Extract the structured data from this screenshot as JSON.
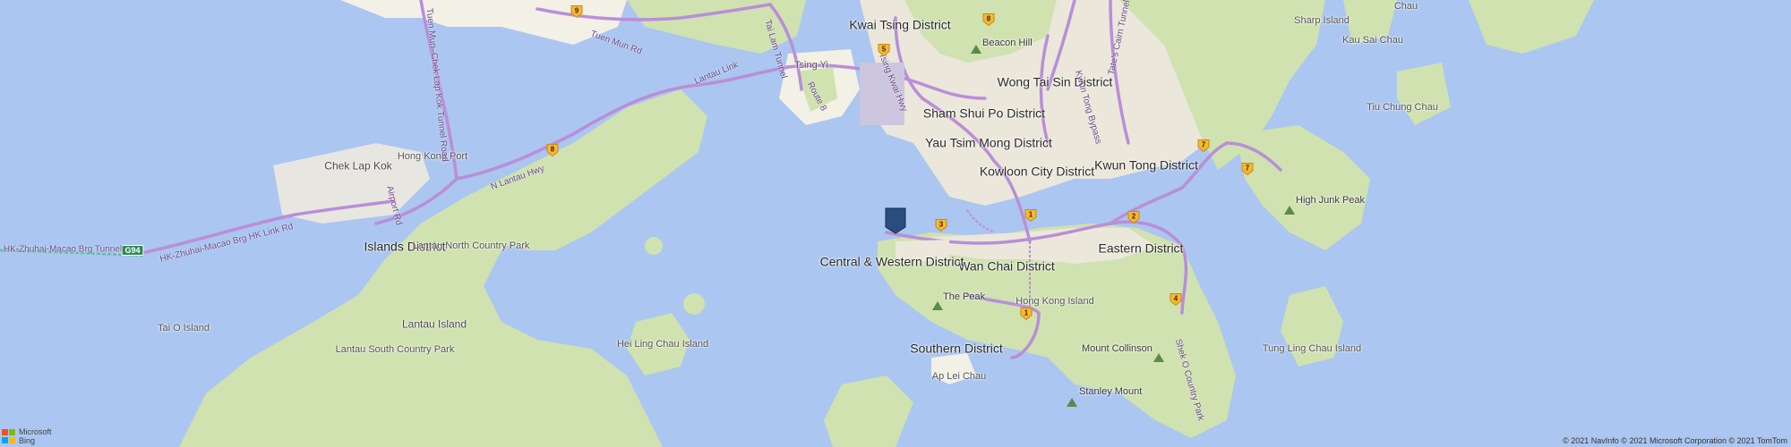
{
  "map": {
    "districts": [
      {
        "id": "kwai-tsing",
        "name": "Kwai Tsing District"
      },
      {
        "id": "wong-tai-sin",
        "name": "Wong Tai Sin District"
      },
      {
        "id": "sham-shui-po",
        "name": "Sham Shui Po District"
      },
      {
        "id": "yau-tsim-mong",
        "name": "Yau Tsim Mong District"
      },
      {
        "id": "kowloon-city",
        "name": "Kowloon City District"
      },
      {
        "id": "kwun-tong",
        "name": "Kwun Tong District"
      },
      {
        "id": "eastern",
        "name": "Eastern District"
      },
      {
        "id": "wan-chai",
        "name": "Wan Chai District"
      },
      {
        "id": "central-western",
        "name": "Central & Western District"
      },
      {
        "id": "southern",
        "name": "Southern District"
      },
      {
        "id": "islands",
        "name": "Islands District"
      }
    ],
    "places": [
      {
        "id": "chek-lap-kok",
        "name": "Chek Lap Kok"
      },
      {
        "id": "hong-kong-port",
        "name": "Hong Kong Port"
      },
      {
        "id": "lantau-north",
        "name": "Lantau North Country Park"
      },
      {
        "id": "lantau-island",
        "name": "Lantau Island"
      },
      {
        "id": "lantau-south",
        "name": "Lantau South Country Park"
      },
      {
        "id": "tai-o",
        "name": "Tai O Island"
      },
      {
        "id": "hei-ling-chau",
        "name": "Hei Ling Chau Island"
      },
      {
        "id": "ap-lei-chau",
        "name": "Ap Lei Chau"
      },
      {
        "id": "tsing-yi",
        "name": "Tsing Yi"
      },
      {
        "id": "hong-kong-island",
        "name": "Hong Kong Island"
      },
      {
        "id": "tung-ling-chau",
        "name": "Tung Ling Chau Island"
      },
      {
        "id": "tiu-chung-chau",
        "name": "Tiu Chung Chau"
      },
      {
        "id": "kau-sai-chau",
        "name": "Kau Sai Chau"
      },
      {
        "id": "sharp-island",
        "name": "Sharp Island"
      },
      {
        "id": "chau",
        "name": "Chau"
      }
    ],
    "pois": [
      {
        "id": "beacon-hill",
        "name": "Beacon Hill"
      },
      {
        "id": "the-peak",
        "name": "The Peak"
      },
      {
        "id": "high-junk-peak",
        "name": "High Junk Peak"
      },
      {
        "id": "mount-collinson",
        "name": "Mount Collinson"
      },
      {
        "id": "stanley-mount",
        "name": "Stanley Mount"
      }
    ],
    "roads": [
      {
        "id": "tuen-mun-chek-lap-kok",
        "name": "Tuen Mun–Chek Lap Kok Tunnel Road"
      },
      {
        "id": "tuen-mun-rd",
        "name": "Tuen Mun Rd"
      },
      {
        "id": "lantau-link",
        "name": "Lantau Link"
      },
      {
        "id": "n-lantau-hwy",
        "name": "N Lantau Hwy"
      },
      {
        "id": "airport-rd",
        "name": "Airport Rd"
      },
      {
        "id": "hzmb-tunnel",
        "name": "HK-Zhuhai-Macao Brg Tunnel"
      },
      {
        "id": "hzmb-link",
        "name": "HK-Zhuhai-Macao Brg HK Link Rd"
      },
      {
        "id": "route-8",
        "name": "Route 8"
      },
      {
        "id": "tai-lam-tunnel",
        "name": "Tai Lam Tunnel"
      },
      {
        "id": "tsing-kwai-hwy",
        "name": "Tsing Kwai Hwy"
      },
      {
        "id": "tate-cairn",
        "name": "Tate's Cairn Tunnel"
      },
      {
        "id": "kwun-tong-bp",
        "name": "Kwun Tong Bypass"
      },
      {
        "id": "shek-o-country-park",
        "name": "Shek O Country Park"
      }
    ],
    "route_shields": [
      {
        "id": "r9",
        "label": "9"
      },
      {
        "id": "r5",
        "label": "5"
      },
      {
        "id": "r8a",
        "label": "8"
      },
      {
        "id": "r8b",
        "label": "8"
      },
      {
        "id": "r7a",
        "label": "7"
      },
      {
        "id": "r7b",
        "label": "7"
      },
      {
        "id": "r3",
        "label": "3"
      },
      {
        "id": "r1a",
        "label": "1"
      },
      {
        "id": "r1b",
        "label": "1"
      },
      {
        "id": "r2",
        "label": "2"
      },
      {
        "id": "r4",
        "label": "4"
      }
    ],
    "route_badge": "G94",
    "pin_color": "#2b4d7d",
    "colors": {
      "water": "#abc6f0",
      "land": "#f3f0e6",
      "park": "#cfe2b0",
      "highway": "#b98ed8",
      "urban": "#ebe7da"
    },
    "brand": {
      "line1": "Microsoft",
      "line2": "Bing"
    },
    "copyright": "© 2021 NavInfo © 2021 Microsoft Corporation © 2021 TomTom"
  }
}
